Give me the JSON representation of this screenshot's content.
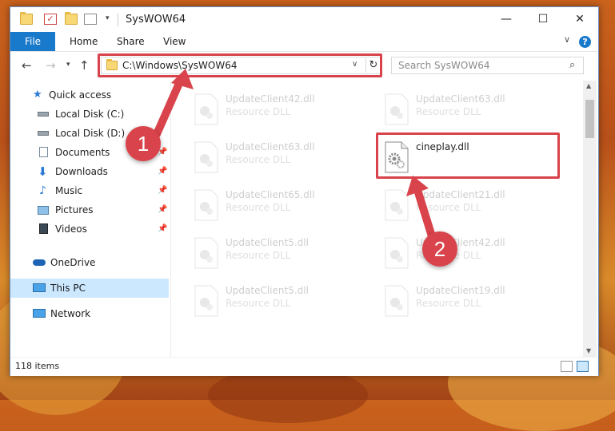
{
  "window": {
    "title": "SysWOW64",
    "controls": {
      "minimize": "—",
      "maximize": "☐",
      "close": "✕"
    }
  },
  "ribbon": {
    "tabs": [
      "File",
      "Home",
      "Share",
      "View"
    ],
    "help": "?"
  },
  "address": {
    "path": "C:\\Windows\\SysWOW64",
    "refresh": "↻"
  },
  "search": {
    "placeholder": "Search SysWOW64"
  },
  "sidebar": {
    "items": [
      {
        "label": "Quick access",
        "icon": "star-icon",
        "pinned": false
      },
      {
        "label": "Local Disk (C:)",
        "icon": "drive-icon",
        "pinned": false
      },
      {
        "label": "Local Disk (D:)",
        "icon": "drive-icon",
        "pinned": false
      },
      {
        "label": "Documents",
        "icon": "documents-icon",
        "pinned": true
      },
      {
        "label": "Downloads",
        "icon": "downloads-icon",
        "pinned": true
      },
      {
        "label": "Music",
        "icon": "music-icon",
        "pinned": true
      },
      {
        "label": "Pictures",
        "icon": "pictures-icon",
        "pinned": true
      },
      {
        "label": "Videos",
        "icon": "videos-icon",
        "pinned": true
      },
      {
        "label": "OneDrive",
        "icon": "onedrive-icon",
        "pinned": false
      },
      {
        "label": "This PC",
        "icon": "computer-icon",
        "pinned": false,
        "selected": true
      },
      {
        "label": "Network",
        "icon": "network-icon",
        "pinned": false
      }
    ]
  },
  "files": {
    "left": [
      {
        "name": "UpdateClient42.dll",
        "type": "Resource DLL"
      },
      {
        "name": "UpdateClient63.dll",
        "type": "Resource DLL"
      },
      {
        "name": "UpdateClient65.dll",
        "type": "Resource DLL"
      },
      {
        "name": "UpdateClient5.dll",
        "type": "Resource DLL"
      },
      {
        "name": "UpdateClient5.dll",
        "type": "Resource DLL"
      }
    ],
    "right": [
      {
        "name": "UpdateClient63.dll",
        "type": "Resource DLL"
      },
      {
        "name": "cineplay.dll",
        "type": "",
        "highlighted": true
      },
      {
        "name": "UpdateClient21.dll",
        "type": "Resource DLL"
      },
      {
        "name": "UpdateClient42.dll",
        "type": "Resource DLL"
      },
      {
        "name": "UpdateClient19.dll",
        "type": "Resource DLL"
      }
    ]
  },
  "status": {
    "item_count": "118 items"
  },
  "annotations": {
    "step1": "1",
    "step2": "2",
    "color": "#d9434b"
  },
  "colors": {
    "accent": "#1979ca",
    "selection": "#cce8ff"
  }
}
